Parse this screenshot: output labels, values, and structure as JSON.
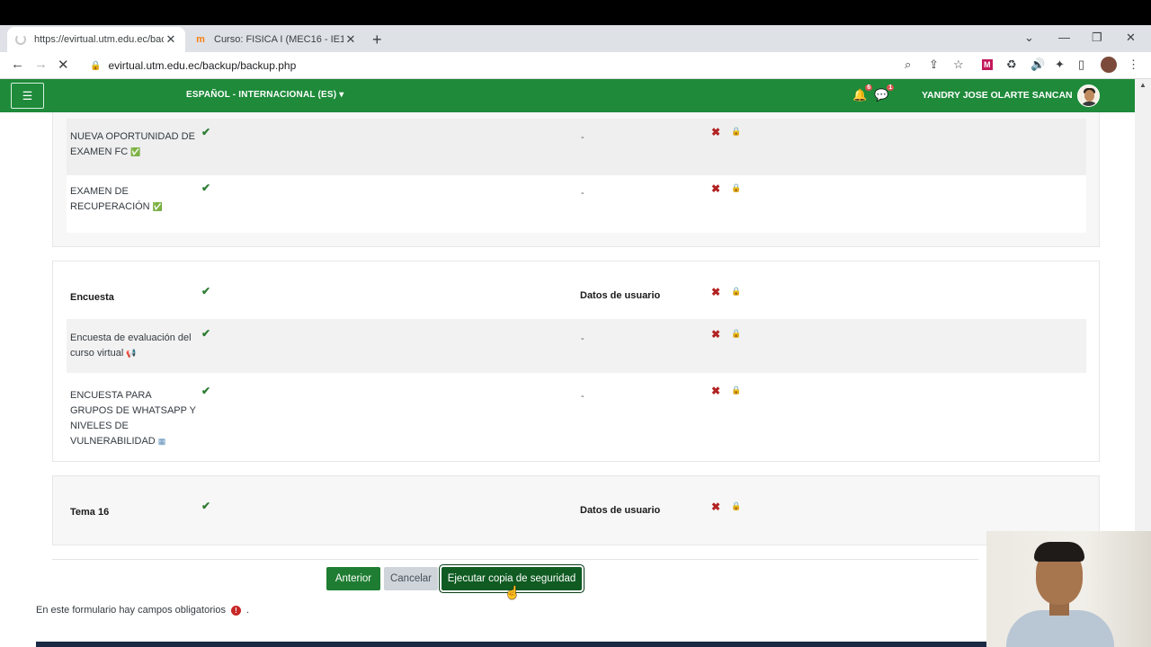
{
  "browser": {
    "tabs": [
      {
        "title": "https://evirtual.utm.edu.ec/backup",
        "active": true,
        "loading": true
      },
      {
        "title": "Curso: FISICA I (MEC16 - IE16 - I",
        "active": false,
        "icon": "moodle-icon"
      }
    ],
    "url": "evirtual.utm.edu.ec/backup/backup.php"
  },
  "navbar": {
    "language": "ESPAÑOL - INTERNACIONAL (ES)",
    "notifications_count": "6",
    "messages_count": "1",
    "user_name": "YANDRY JOSE OLARTE SANCAN"
  },
  "sections": [
    {
      "items": [
        {
          "name": "NUEVA OPORTUNIDAD DE EXAMEN FC",
          "icon": "quiz-icon",
          "user_data": "-"
        },
        {
          "name": "EXAMEN DE RECUPERACIÓN",
          "icon": "quiz-icon",
          "user_data": "-"
        }
      ]
    },
    {
      "title": "Encuesta",
      "user_data_label": "Datos de usuario",
      "items": [
        {
          "name": "Encuesta de evaluación del curso virtual",
          "icon": "feedback-icon",
          "user_data": "-"
        },
        {
          "name": "ENCUESTA PARA GRUPOS DE WHATSAPP Y NIVELES DE VULNERABILIDAD",
          "icon": "survey-icon",
          "user_data": "-"
        }
      ]
    },
    {
      "title": "Tema 16",
      "user_data_label": "Datos de usuario"
    }
  ],
  "buttons": {
    "previous": "Anterior",
    "cancel": "Cancelar",
    "execute": "Ejecutar copia de seguridad"
  },
  "required_note": "En este formulario hay campos obligatorios",
  "required_note_end": "."
}
